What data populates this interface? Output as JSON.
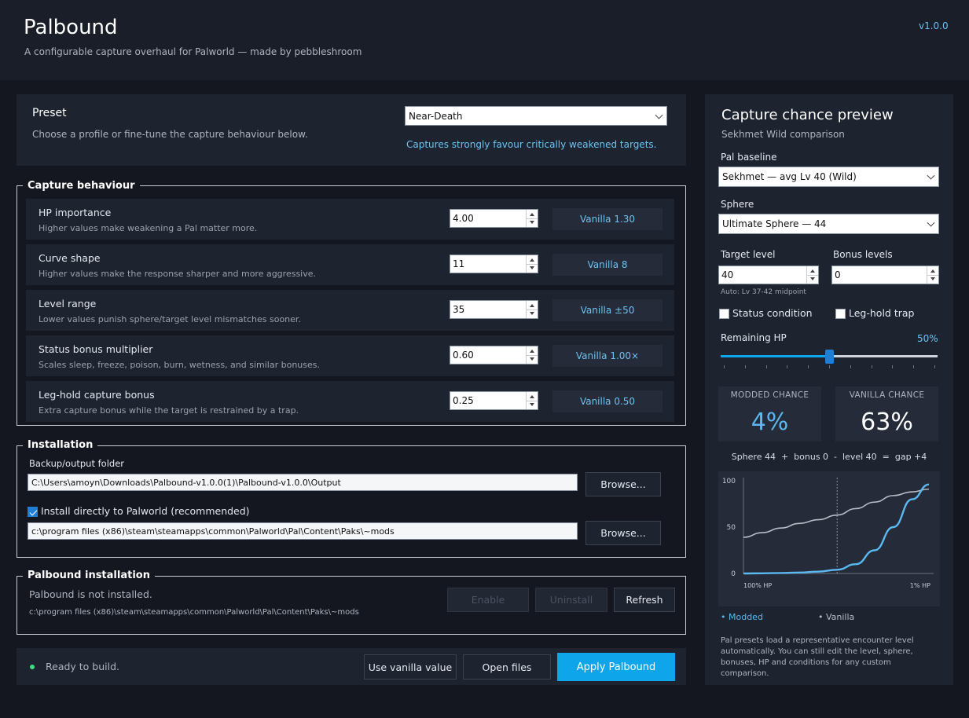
{
  "header": {
    "title": "Palbound",
    "subtitle": "A configurable capture overhaul for Palworld — made by pebbleshroom",
    "version": "v1.0.0"
  },
  "preset": {
    "title": "Preset",
    "description": "Choose a profile or fine-tune the capture behaviour below.",
    "selected": "Near-Death",
    "note": "Captures strongly favour critically weakened targets."
  },
  "capture_behaviour": {
    "title": "Capture behaviour",
    "rows": [
      {
        "name": "HP importance",
        "hint": "Higher values make weakening a Pal matter more.",
        "value": "4.00",
        "vanilla": "Vanilla 1.30"
      },
      {
        "name": "Curve shape",
        "hint": "Higher values make the response sharper and more aggressive.",
        "value": "11",
        "vanilla": "Vanilla  8"
      },
      {
        "name": "Level range",
        "hint": "Lower values punish sphere/target level mismatches sooner.",
        "value": "35",
        "vanilla": "Vanilla  ±50"
      },
      {
        "name": "Status bonus multiplier",
        "hint": "Scales sleep, freeze, poison, burn, wetness, and similar bonuses.",
        "value": "0.60",
        "vanilla": "Vanilla 1.00×"
      },
      {
        "name": "Leg-hold capture bonus",
        "hint": "Extra capture bonus while the target is restrained by a trap.",
        "value": "0.25",
        "vanilla": "Vanilla  0.50"
      }
    ]
  },
  "installation": {
    "title": "Installation",
    "backup_label": "Backup/output folder",
    "backup_path": "C:\\Users\\amoyn\\Downloads\\Palbound-v1.0.0(1)\\Palbound-v1.0.0\\Output",
    "browse_label": "Browse...",
    "direct_label": "Install directly to Palworld (recommended)",
    "direct_checked": true,
    "mods_path": "c:\\program files (x86)\\steam\\steamapps\\common\\Palworld\\Pal\\Content\\Paks\\~mods"
  },
  "palbound_installation": {
    "title": "Palbound installation",
    "status": "Palbound is not installed.",
    "path": "c:\\program files (x86)\\steam\\steamapps\\common\\Palworld\\Pal\\Content\\Paks\\~mods",
    "enable_label": "Enable",
    "uninstall_label": "Uninstall",
    "refresh_label": "Refresh"
  },
  "footer": {
    "status": "Ready to build.",
    "use_vanilla_label": "Use  vanilla value",
    "open_files_label": "Open files",
    "apply_label": "Apply Palbound"
  },
  "preview": {
    "title": "Capture chance preview",
    "subtitle": "Sekhmet Wild comparison",
    "baseline_label": "Pal baseline",
    "baseline_value": "Sekhmet — avg Lv 40 (Wild)",
    "sphere_label": "Sphere",
    "sphere_value": "Ultimate Sphere — 44",
    "target_level_label": "Target level",
    "target_level_value": "40",
    "bonus_levels_label": "Bonus levels",
    "bonus_levels_value": "0",
    "auto_note": "Auto: Lv 37-42 midpoint",
    "status_label": "Status condition",
    "leghold_label": "Leg-hold trap",
    "remaining_hp_label": "Remaining HP",
    "remaining_hp_value": "50%",
    "remaining_hp_fraction": 0.5,
    "modded_label": "MODDED CHANCE",
    "modded_value": "4%",
    "vanilla_label": "VANILLA CHANCE",
    "vanilla_value": "63%",
    "gap_formula": "Sphere 44  +  bonus 0  -  level 40  =  gap +4",
    "legend_modded": "• Modded",
    "legend_vanilla": "• Vanilla",
    "footnote": "Pal presets load a representative encounter level automatically. You can still edit the level, sphere, bonuses, HP and conditions for any custom comparison.",
    "colors": {
      "modded": "#5bb8f0",
      "vanilla": "#b9bcc6",
      "accent": "#0ea5ea"
    }
  },
  "chart_data": {
    "type": "line",
    "xlabel": "",
    "ylabel": "",
    "x_tick_labels": [
      "100% HP",
      "1% HP"
    ],
    "y_ticks": [
      0,
      50,
      100
    ],
    "ylim": [
      0,
      100
    ],
    "x": [
      100,
      90,
      80,
      70,
      60,
      50,
      40,
      30,
      20,
      10,
      1
    ],
    "series": [
      {
        "name": "Modded",
        "values": [
          0,
          0.2,
          0.5,
          1,
          2,
          4,
          10,
          25,
          50,
          80,
          96
        ]
      },
      {
        "name": "Vanilla",
        "values": [
          39,
          44,
          49,
          54,
          58,
          63,
          70,
          77,
          84,
          88,
          91
        ]
      }
    ],
    "marker_x": 50
  }
}
